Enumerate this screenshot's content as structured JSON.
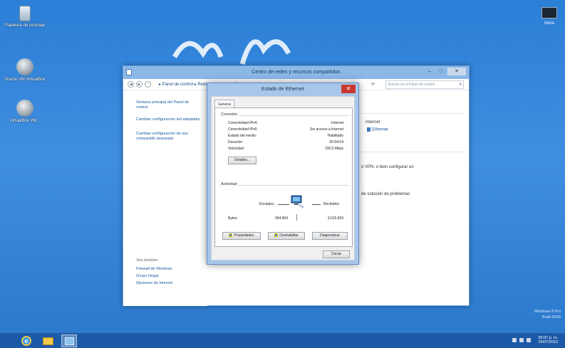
{
  "desktop": {
    "icons": [
      {
        "label": "Papelera de reciclaje",
        "icon": "recycle-bin-icon"
      },
      {
        "label": "Oracle VM VirtualBox",
        "icon": "virtualbox-icon"
      },
      {
        "label": "VirtualBox VM...",
        "icon": "virtualbox-vm-icon"
      }
    ],
    "top_right_icon_label": "Inicio",
    "watermark_line1": "Windows 8 Pro",
    "watermark_line2": "Build 9200"
  },
  "explorer": {
    "title": "Centro de redes y recursos compartidos",
    "breadcrumb": "▸ Panel de control ▸ Redes e Internet ▸ Centro de redes y recursos compartidos",
    "search_placeholder": "Buscar en el Panel de control",
    "left_pane": {
      "home": "Ventana principal del Panel de control",
      "adapter": "Cambiar configuración del adaptador",
      "sharing": "Cambiar configuración de uso compartido avanzado",
      "see_also": "Vea también",
      "firewall": "Firewall de Windows",
      "homegroup": "Grupo Hogar",
      "internet_options": "Opciones de Internet"
    },
    "right_pane": {
      "internet_label": "Internet",
      "ethernet_link": "Ethernet",
      "vpn_text": "o VPN; o bien configurar un",
      "troubleshoot_text": "de solución de problemas"
    }
  },
  "dialog": {
    "title": "Estado de Ethernet",
    "tab_general": "General",
    "connection": {
      "group_label": "Conexión",
      "rows": [
        {
          "label": "Conectividad IPv4:",
          "value": "Internet"
        },
        {
          "label": "Conectividad IPv6:",
          "value": "Sin acceso a Internet"
        },
        {
          "label": "Estado del medio:",
          "value": "Habilitado"
        },
        {
          "label": "Duración:",
          "value": "00:04:54"
        },
        {
          "label": "Velocidad:",
          "value": "100,0 Mbps"
        }
      ],
      "details_button": "Detalles..."
    },
    "activity": {
      "group_label": "Actividad",
      "sent_label": "Enviados",
      "received_label": "Recibidos",
      "bytes_label": "Bytes:",
      "bytes_sent": "364.469",
      "bytes_received": "3.015.839"
    },
    "buttons": {
      "properties": "Propiedades",
      "disable": "Deshabilitar",
      "diagnose": "Diagnosticar",
      "close": "Cerrar"
    }
  },
  "taskbar": {
    "clock_time": "05:07 p. m.",
    "clock_date": "24/07/2013"
  }
}
